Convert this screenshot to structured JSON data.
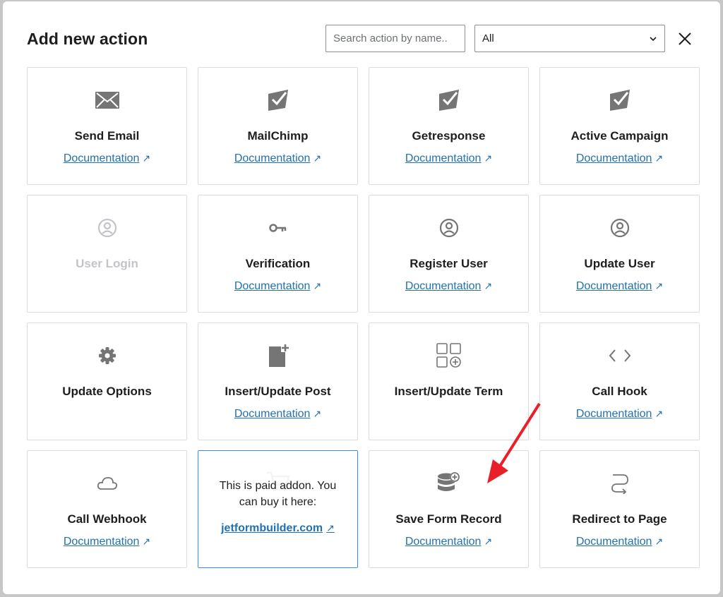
{
  "modal": {
    "title": "Add new action",
    "search": {
      "placeholder": "Search action by name..",
      "value": ""
    },
    "filter": {
      "selected": "All"
    },
    "close_icon": "close-icon"
  },
  "actions": [
    {
      "label": "Send Email",
      "icon": "envelope-icon",
      "doc": "Documentation"
    },
    {
      "label": "MailChimp",
      "icon": "send-check-icon",
      "doc": "Documentation"
    },
    {
      "label": "Getresponse",
      "icon": "send-check-icon",
      "doc": "Documentation"
    },
    {
      "label": "Active Campaign",
      "icon": "send-check-icon",
      "doc": "Documentation"
    },
    {
      "label": "User Login",
      "icon": "user-circle-icon",
      "disabled": true
    },
    {
      "label": "Verification",
      "icon": "key-icon",
      "doc": "Documentation"
    },
    {
      "label": "Register User",
      "icon": "user-circle-icon",
      "doc": "Documentation"
    },
    {
      "label": "Update User",
      "icon": "user-circle-icon",
      "doc": "Documentation"
    },
    {
      "label": "Update Options",
      "icon": "gear-icon"
    },
    {
      "label": "Insert/Update Post",
      "icon": "post-add-icon",
      "doc": "Documentation"
    },
    {
      "label": "Insert/Update Term",
      "icon": "term-grid-icon"
    },
    {
      "label": "Call Hook",
      "icon": "code-icon",
      "doc": "Documentation"
    },
    {
      "label": "Call Webhook",
      "icon": "cloud-icon",
      "doc": "Documentation"
    },
    {
      "paid": true,
      "paid_text": "This is paid addon. You can buy it here:",
      "paid_link": "jetformbuilder.com",
      "icon": "cart-icon"
    },
    {
      "label": "Save Form Record",
      "icon": "database-add-icon",
      "doc": "Documentation"
    },
    {
      "label": "Redirect to Page",
      "icon": "redirect-icon",
      "doc": "Documentation"
    }
  ],
  "colors": {
    "link": "#2271b1",
    "icon": "#757575",
    "annotation": "#e8202a"
  }
}
